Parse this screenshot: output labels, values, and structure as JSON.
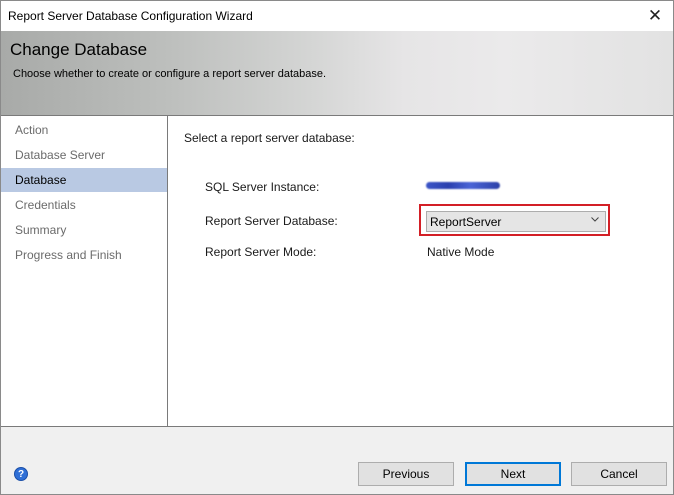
{
  "window": {
    "title": "Report Server Database Configuration Wizard"
  },
  "header": {
    "title": "Change Database",
    "subtitle": "Choose whether to create or configure a report server database."
  },
  "nav": {
    "items": [
      {
        "label": "Action"
      },
      {
        "label": "Database Server"
      },
      {
        "label": "Database"
      },
      {
        "label": "Credentials"
      },
      {
        "label": "Summary"
      },
      {
        "label": "Progress and Finish"
      }
    ],
    "active_index": 2
  },
  "content": {
    "intro": "Select a report server database:",
    "fields": {
      "instance_label": "SQL Server Instance:",
      "database_label": "Report Server Database:",
      "database_value": "ReportServer",
      "mode_label": "Report Server Mode:",
      "mode_value": "Native Mode"
    }
  },
  "footer": {
    "previous_label": "Previous",
    "next_label": "Next",
    "cancel_label": "Cancel",
    "help_glyph": "?"
  },
  "colors": {
    "active_nav": "#b9c9e3",
    "highlight_border": "#d31f26",
    "default_button": "#0078d7"
  },
  "icons": {
    "close": "close-icon",
    "help": "help-icon",
    "dropdown": "chevron-down-icon"
  }
}
